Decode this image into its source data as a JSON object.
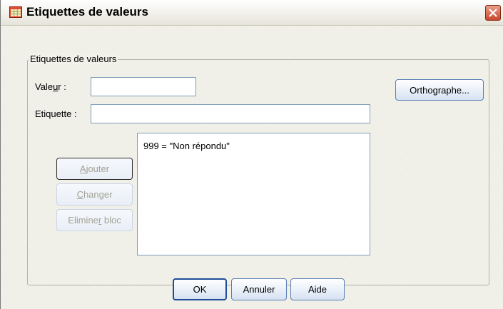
{
  "window": {
    "title": "Etiquettes de valeurs",
    "icon": "grid-table-icon",
    "close_icon": "close-x-icon"
  },
  "group": {
    "legend": "Etiquettes de valeurs"
  },
  "fields": {
    "valeur_label": "Valeur :",
    "valeur_value": "",
    "etiquette_label": "Etiquette :",
    "etiquette_value": ""
  },
  "buttons": {
    "orthographe": "Orthographe...",
    "ajouter": "Ajouter",
    "changer": "Changer",
    "eliminer": "Eliminer bloc",
    "ok": "OK",
    "annuler": "Annuler",
    "aide": "Aide"
  },
  "list": {
    "items": [
      "999 = \"Non répondu\""
    ]
  },
  "colors": {
    "dialog_bg": "#f2f1ea",
    "button_border": "#5a7fb4",
    "close_red": "#c9472c"
  }
}
